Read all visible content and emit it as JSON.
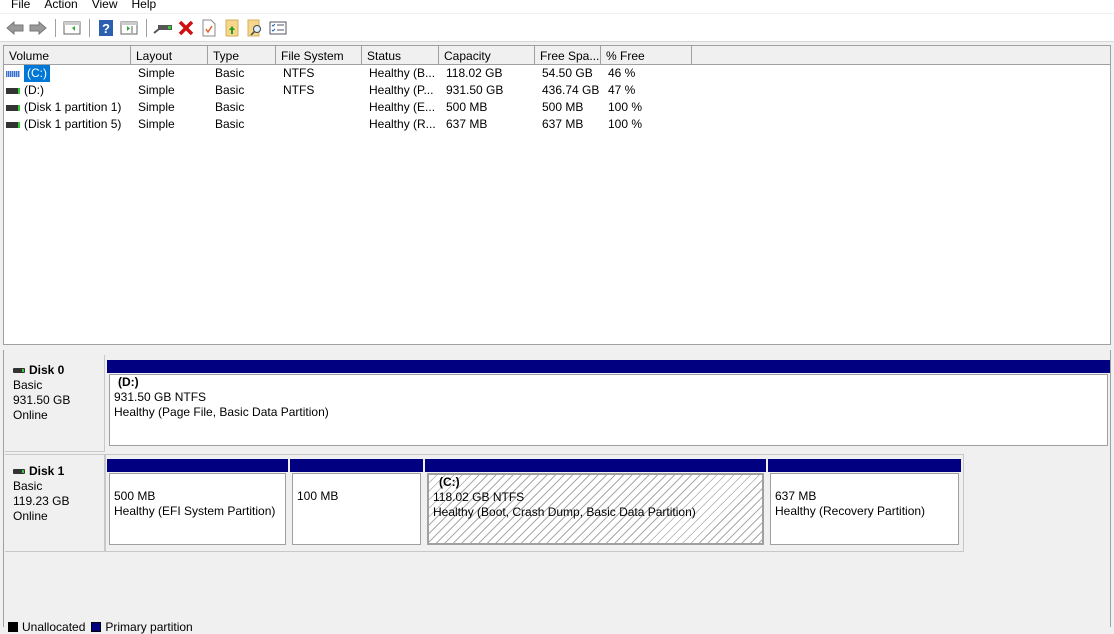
{
  "menu": [
    "File",
    "Action",
    "View",
    "Help"
  ],
  "toolbar": {
    "icons": [
      "back-icon",
      "forward-icon",
      "show-hide-console-tree-icon",
      "help-icon",
      "show-hide-action-pane-icon",
      "connect-drive-icon",
      "delete-icon",
      "properties-icon",
      "open-folder-icon",
      "explore-icon",
      "checklist-icon"
    ]
  },
  "volume_table": {
    "columns": [
      "Volume",
      "Layout",
      "Type",
      "File System",
      "Status",
      "Capacity",
      "Free Spa...",
      "% Free"
    ],
    "rows": [
      {
        "volume": "(C:)",
        "layout": "Simple",
        "type": "Basic",
        "fs": "NTFS",
        "status": "Healthy (B...",
        "capacity": "118.02 GB",
        "free": "54.50 GB",
        "pct": "46 %",
        "selected": true
      },
      {
        "volume": "(D:)",
        "layout": "Simple",
        "type": "Basic",
        "fs": "NTFS",
        "status": "Healthy (P...",
        "capacity": "931.50 GB",
        "free": "436.74 GB",
        "pct": "47 %"
      },
      {
        "volume": "(Disk 1 partition 1)",
        "layout": "Simple",
        "type": "Basic",
        "fs": "",
        "status": "Healthy (E...",
        "capacity": "500 MB",
        "free": "500 MB",
        "pct": "100 %"
      },
      {
        "volume": "(Disk 1 partition 5)",
        "layout": "Simple",
        "type": "Basic",
        "fs": "",
        "status": "Healthy (R...",
        "capacity": "637 MB",
        "free": "637 MB",
        "pct": "100 %"
      }
    ]
  },
  "disks": [
    {
      "name": "Disk 0",
      "type": "Basic",
      "size": "931.50 GB",
      "state": "Online",
      "partitions": [
        {
          "title": "(D:)",
          "size": "931.50 GB NTFS",
          "status": "Healthy (Page File, Basic Data Partition)"
        }
      ]
    },
    {
      "name": "Disk 1",
      "type": "Basic",
      "size": "119.23 GB",
      "state": "Online",
      "partitions": [
        {
          "title": "",
          "size": "500 MB",
          "status": "Healthy (EFI System Partition)"
        },
        {
          "title": "",
          "size": "100 MB",
          "status": ""
        },
        {
          "title": "(C:)",
          "size": "118.02 GB NTFS",
          "status": "Healthy (Boot, Crash Dump, Basic Data Partition)",
          "selected": true
        },
        {
          "title": "",
          "size": "637 MB",
          "status": "Healthy (Recovery Partition)"
        }
      ]
    }
  ],
  "legend": [
    {
      "label": "Unallocated",
      "color": "#000000"
    },
    {
      "label": "Primary partition",
      "color": "#000080"
    }
  ]
}
